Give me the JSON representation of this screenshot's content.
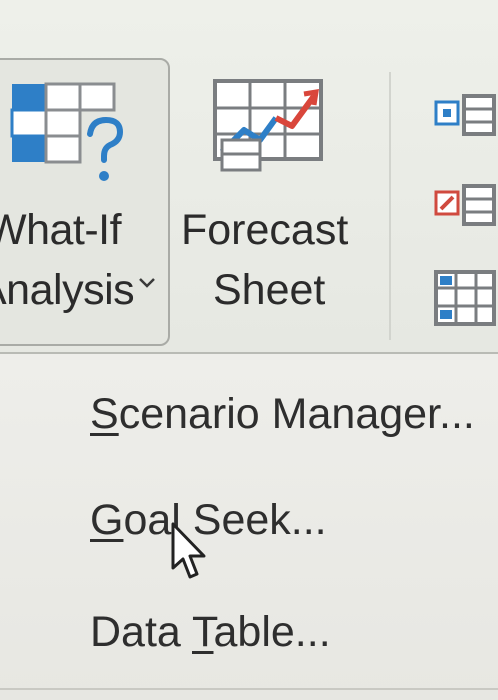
{
  "ribbon": {
    "what_if": {
      "label_line1": "What-If",
      "label_line2": "Analysis",
      "icon": "what-if-table-icon",
      "chevron": "chevron-down-icon"
    },
    "forecast": {
      "label_line1": "Forecast",
      "label_line2": "Sheet",
      "icon": "forecast-chart-icon"
    },
    "outline_icons": [
      "group-icon",
      "ungroup-icon",
      "subtotal-icon"
    ]
  },
  "menu": {
    "items": [
      {
        "underline": "S",
        "rest": "cenario Manager..."
      },
      {
        "underline": "G",
        "rest": "oal Seek..."
      },
      {
        "before": "Data ",
        "underline": "T",
        "rest": "able..."
      }
    ]
  },
  "colors": {
    "accent_blue": "#2e7fc7",
    "icon_outline": "#7a7d80",
    "forecast_red": "#d9463b",
    "outline_red": "#d04a3f"
  }
}
